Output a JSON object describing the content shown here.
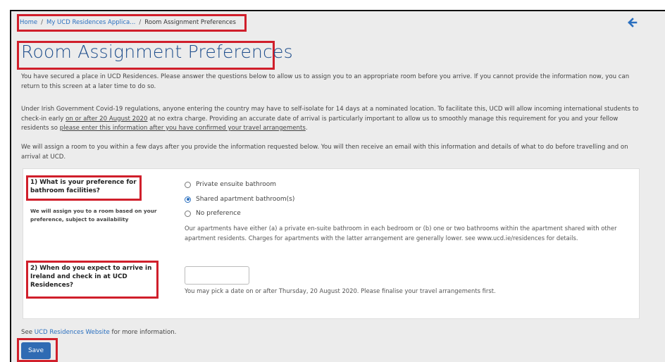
{
  "breadcrumb": {
    "home": "Home",
    "separator": "/",
    "applications": "My UCD Residences Applica...",
    "current": "Room Assignment Preferences"
  },
  "back_icon": "arrow-left-icon",
  "page_title": "Room Assignment Preferences",
  "intro": {
    "p1": "You have secured a place in UCD Residences. Please answer the questions below to allow us to assign you to an appropriate room before you arrive. If you cannot provide the information now, you can return to this screen at a later time to do so.",
    "p2_a": "Under Irish Government Covid-19 regulations, anyone entering the country may have to self-isolate for 14 days at a nominated location. To facilitate this, UCD will allow incoming international students to check-in early ",
    "p2_u1": "on or after 20 August 2020",
    "p2_b": " at no extra charge. Providing an accurate date of arrival is particularly important to allow us to smoothly manage this requirement for you and your fellow residents so ",
    "p2_u2": "please enter this information after you have confirmed your travel arrangements",
    "p2_c": ".",
    "p3": "We will assign a room to you within a few days after you provide the information requested below. You will then receive an email with this information and details of what to do before travelling and on arrival at UCD."
  },
  "question1": {
    "label": "1) What is your preference for bathroom facilities?",
    "note": "We will assign you to a room based on your preference, subject to availability",
    "options": [
      {
        "label": "Private ensuite bathroom",
        "selected": false
      },
      {
        "label": "Shared apartment bathroom(s)",
        "selected": true
      },
      {
        "label": "No preference",
        "selected": false
      }
    ],
    "help": "Our apartments have either (a) a private en-suite bathroom in each bedroom or (b) one or two bathrooms within the apartment shared with other apartment residents. Charges for apartments with the latter arrangement are generally lower. see www.ucd.ie/residences for details."
  },
  "question2": {
    "label": "2) When do you expect to arrive in Ireland and check in at UCD Residences?",
    "date_value": "",
    "help": "You may pick a date on or after Thursday, 20 August 2020. Please finalise your travel arrangements first."
  },
  "footer": {
    "prefix": "See ",
    "link": "UCD Residences Website",
    "suffix": " for more information."
  },
  "save_label": "Save",
  "colors": {
    "highlight": "#d01f2b",
    "link": "#2a6fbf",
    "title": "#1f4e8c",
    "button": "#2f6bb3"
  }
}
